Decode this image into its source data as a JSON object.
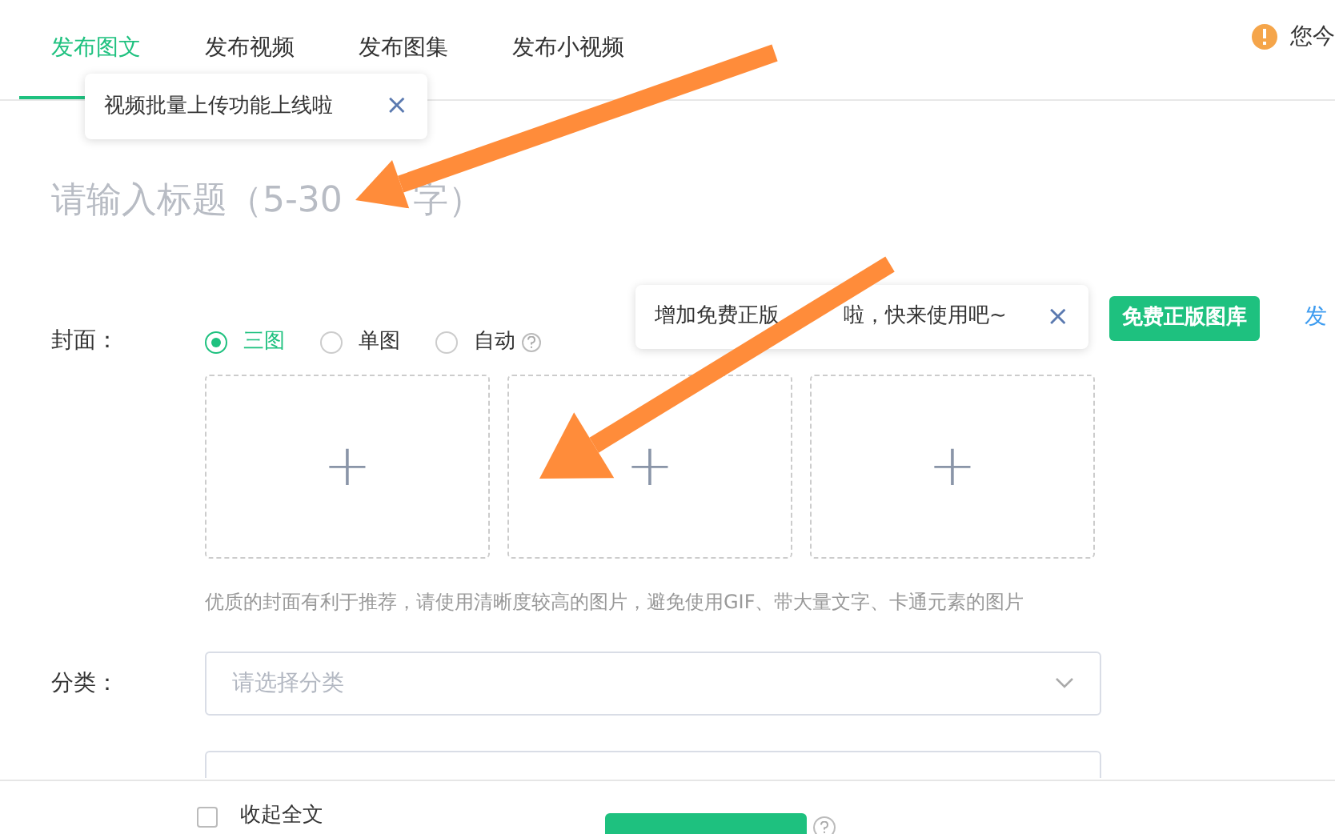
{
  "tabs": [
    {
      "label": "发布图文",
      "selected": true
    },
    {
      "label": "发布视频",
      "selected": false
    },
    {
      "label": "发布图集",
      "selected": false
    },
    {
      "label": "发布小视频",
      "selected": false
    }
  ],
  "notice": {
    "text": "您今"
  },
  "tab_tooltip": {
    "text": "视频批量上传功能上线啦",
    "close": "×"
  },
  "title_field": {
    "placeholder_parts": [
      "请输入标题（5-30",
      "字）"
    ]
  },
  "cover": {
    "label": "封面：",
    "options": [
      {
        "label": "三图",
        "selected": true,
        "help": false
      },
      {
        "label": "单图",
        "selected": false,
        "help": false
      },
      {
        "label": "自动",
        "selected": false,
        "help": true
      }
    ],
    "slots": [
      {
        "icon": "+"
      },
      {
        "icon": "+"
      },
      {
        "icon": "+"
      }
    ],
    "hint": "优质的封面有利于推荐，请使用清晰度较高的图片，避免使用GIF、带大量文字、卡通元素的图片"
  },
  "library_tooltip": {
    "text_parts": [
      "增加免费正版",
      "啦，快来使用吧~"
    ],
    "close": "×"
  },
  "library_button": "免费正版图库",
  "side_link": "发",
  "category": {
    "label": "分类：",
    "placeholder": "请选择分类"
  },
  "tags": {
    "kind": "field"
  },
  "footer": {
    "collapse": {
      "label": "收起全文",
      "checked": false
    }
  }
}
